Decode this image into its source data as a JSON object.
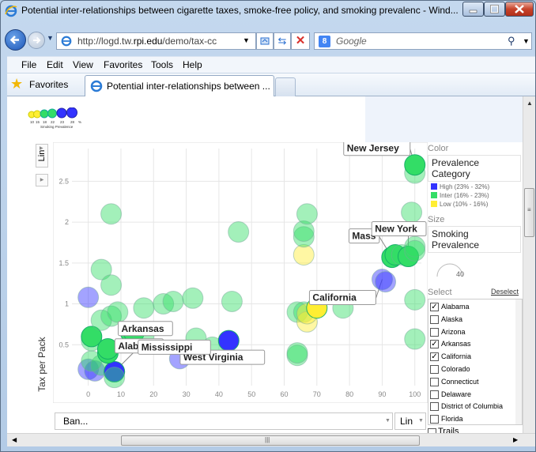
{
  "window": {
    "title": "Potential inter-relationships between cigarette taxes, smoke-free policy, and smoking prevalenc - Wind..."
  },
  "address": {
    "url_prefix": "http://logd.tw.",
    "url_domain": "rpi.edu",
    "url_suffix": "/demo/tax-cc"
  },
  "search": {
    "placeholder": "Google",
    "provider_glyph": "8"
  },
  "menu": {
    "items": [
      "File",
      "Edit",
      "View",
      "Favorites",
      "Tools",
      "Help"
    ]
  },
  "favorites_bar": {
    "favorites_label": "Favorites",
    "tab_label": "Potential inter-relationships between ..."
  },
  "chart_controls": {
    "y_scale": "Lin",
    "y_label": "Tax per Pack",
    "x_select": "Ban...",
    "x_scale": "Lin"
  },
  "side_panel": {
    "color_heading": "Color",
    "color_value": "Prevalence Category",
    "color_legend": [
      {
        "label": "High (23% - 32%)",
        "color": "#3333ff"
      },
      {
        "label": "Inter (16% - 23%)",
        "color": "#33dd66"
      },
      {
        "label": "Low (10% - 16%)",
        "color": "#ffee33"
      }
    ],
    "size_heading": "Size",
    "size_value": "Smoking Prevalence",
    "size_dial_value": "40",
    "select_heading": "Select",
    "deselect_label": "Deselect",
    "states": [
      {
        "name": "Alabama",
        "checked": true
      },
      {
        "name": "Alaska",
        "checked": false
      },
      {
        "name": "Arizona",
        "checked": false
      },
      {
        "name": "Arkansas",
        "checked": true
      },
      {
        "name": "California",
        "checked": true
      },
      {
        "name": "Colorado",
        "checked": false
      },
      {
        "name": "Connecticut",
        "checked": false
      },
      {
        "name": "Delaware",
        "checked": false
      },
      {
        "name": "District of Columbia",
        "checked": false
      },
      {
        "name": "Florida",
        "checked": false
      }
    ],
    "trails_label": "Trails"
  },
  "size_legend": {
    "ticks": [
      "10",
      "15",
      "18",
      "22",
      "23",
      "28",
      "%"
    ],
    "caption": "Smoking Prevalence"
  },
  "chart_data": {
    "type": "scatter",
    "ylabel": "Tax per Pack",
    "xlim": [
      -5,
      102
    ],
    "ylim": [
      0,
      2.9
    ],
    "x_ticks": [
      0,
      10,
      20,
      30,
      40,
      50,
      60,
      70,
      80,
      90,
      100
    ],
    "y_ticks": [
      0.5,
      1,
      1.5,
      2,
      2.5
    ],
    "grid": true,
    "category_colors": {
      "high": "#3333ff",
      "inter": "#33dd66",
      "low": "#ffee33"
    },
    "points": [
      {
        "x": 0,
        "y": 0.2,
        "cat": "high",
        "sel": false
      },
      {
        "x": 2,
        "y": 0.18,
        "cat": "high",
        "sel": false
      },
      {
        "x": 4,
        "y": 0.25,
        "cat": "inter",
        "sel": false
      },
      {
        "x": 8,
        "y": 0.17,
        "cat": "high",
        "sel": true
      },
      {
        "x": 8,
        "y": 0.1,
        "cat": "inter",
        "sel": false
      },
      {
        "x": 1,
        "y": 0.3,
        "cat": "inter",
        "sel": false
      },
      {
        "x": 1,
        "y": 0.55,
        "cat": "inter",
        "sel": false
      },
      {
        "x": 1,
        "y": 0.6,
        "cat": "inter",
        "sel": true
      },
      {
        "x": 6,
        "y": 0.4,
        "cat": "inter",
        "sel": true
      },
      {
        "x": 6,
        "y": 0.45,
        "cat": "inter",
        "sel": true
      },
      {
        "x": 13,
        "y": 0.65,
        "cat": "inter",
        "sel": true
      },
      {
        "x": 14,
        "y": 0.65,
        "cat": "inter",
        "sel": true
      },
      {
        "x": 17,
        "y": 0.6,
        "cat": "inter",
        "sel": false
      },
      {
        "x": 0,
        "y": 1.08,
        "cat": "high",
        "sel": false
      },
      {
        "x": 4,
        "y": 0.8,
        "cat": "inter",
        "sel": false
      },
      {
        "x": 7,
        "y": 0.85,
        "cat": "inter",
        "sel": false
      },
      {
        "x": 9,
        "y": 0.9,
        "cat": "inter",
        "sel": false
      },
      {
        "x": 4,
        "y": 1.42,
        "cat": "inter",
        "sel": false
      },
      {
        "x": 7,
        "y": 1.23,
        "cat": "inter",
        "sel": false
      },
      {
        "x": 7,
        "y": 2.1,
        "cat": "inter",
        "sel": false
      },
      {
        "x": 17,
        "y": 0.95,
        "cat": "inter",
        "sel": false
      },
      {
        "x": 23,
        "y": 1.0,
        "cat": "inter",
        "sel": false
      },
      {
        "x": 26,
        "y": 1.03,
        "cat": "inter",
        "sel": false
      },
      {
        "x": 32,
        "y": 1.07,
        "cat": "inter",
        "sel": false
      },
      {
        "x": 28,
        "y": 0.33,
        "cat": "high",
        "sel": false
      },
      {
        "x": 33,
        "y": 0.58,
        "cat": "inter",
        "sel": false
      },
      {
        "x": 38,
        "y": 0.47,
        "cat": "inter",
        "sel": false
      },
      {
        "x": 43,
        "y": 0.55,
        "cat": "high",
        "sel": true
      },
      {
        "x": 44,
        "y": 1.03,
        "cat": "inter",
        "sel": false
      },
      {
        "x": 46,
        "y": 1.88,
        "cat": "inter",
        "sel": false
      },
      {
        "x": 64,
        "y": 0.37,
        "cat": "inter",
        "sel": false
      },
      {
        "x": 64,
        "y": 0.4,
        "cat": "inter",
        "sel": false
      },
      {
        "x": 64,
        "y": 0.9,
        "cat": "inter",
        "sel": false
      },
      {
        "x": 66,
        "y": 0.9,
        "cat": "inter",
        "sel": false
      },
      {
        "x": 67,
        "y": 0.78,
        "cat": "low",
        "sel": false
      },
      {
        "x": 67,
        "y": 0.88,
        "cat": "low",
        "sel": false
      },
      {
        "x": 70,
        "y": 0.95,
        "cat": "low",
        "sel": true
      },
      {
        "x": 66,
        "y": 1.6,
        "cat": "low",
        "sel": false
      },
      {
        "x": 66,
        "y": 1.82,
        "cat": "inter",
        "sel": false
      },
      {
        "x": 66,
        "y": 1.89,
        "cat": "inter",
        "sel": false
      },
      {
        "x": 67,
        "y": 2.1,
        "cat": "inter",
        "sel": false
      },
      {
        "x": 78,
        "y": 0.95,
        "cat": "inter",
        "sel": false
      },
      {
        "x": 90,
        "y": 1.3,
        "cat": "high",
        "sel": false
      },
      {
        "x": 91,
        "y": 1.27,
        "cat": "high",
        "sel": false
      },
      {
        "x": 93,
        "y": 1.57,
        "cat": "inter",
        "sel": true
      },
      {
        "x": 94,
        "y": 1.6,
        "cat": "inter",
        "sel": true
      },
      {
        "x": 96,
        "y": 1.6,
        "cat": "inter",
        "sel": false
      },
      {
        "x": 98,
        "y": 1.58,
        "cat": "inter",
        "sel": true
      },
      {
        "x": 100,
        "y": 1.7,
        "cat": "inter",
        "sel": false
      },
      {
        "x": 100,
        "y": 1.65,
        "cat": "inter",
        "sel": false
      },
      {
        "x": 99,
        "y": 2.12,
        "cat": "inter",
        "sel": false
      },
      {
        "x": 100,
        "y": 2.6,
        "cat": "inter",
        "sel": false
      },
      {
        "x": 100,
        "y": 2.7,
        "cat": "inter",
        "sel": true
      },
      {
        "x": 100,
        "y": 1.05,
        "cat": "inter",
        "sel": false
      },
      {
        "x": 100,
        "y": 0.57,
        "cat": "inter",
        "sel": false
      }
    ],
    "labels": [
      {
        "text": "New Jersey",
        "x": 100,
        "y": 2.7
      },
      {
        "text": "Mass",
        "x": 93,
        "y": 1.57
      },
      {
        "text": "New York",
        "x": 98,
        "y": 1.58
      },
      {
        "text": "California",
        "x": 90,
        "y": 1.3
      },
      {
        "text": "West Virginia",
        "x": 43,
        "y": 0.55
      },
      {
        "text": "Arkansas",
        "x": 14,
        "y": 0.65
      },
      {
        "text": "Alabama",
        "x": 13,
        "y": 0.65
      },
      {
        "text": "Mississippi",
        "x": 8,
        "y": 0.17
      }
    ]
  }
}
